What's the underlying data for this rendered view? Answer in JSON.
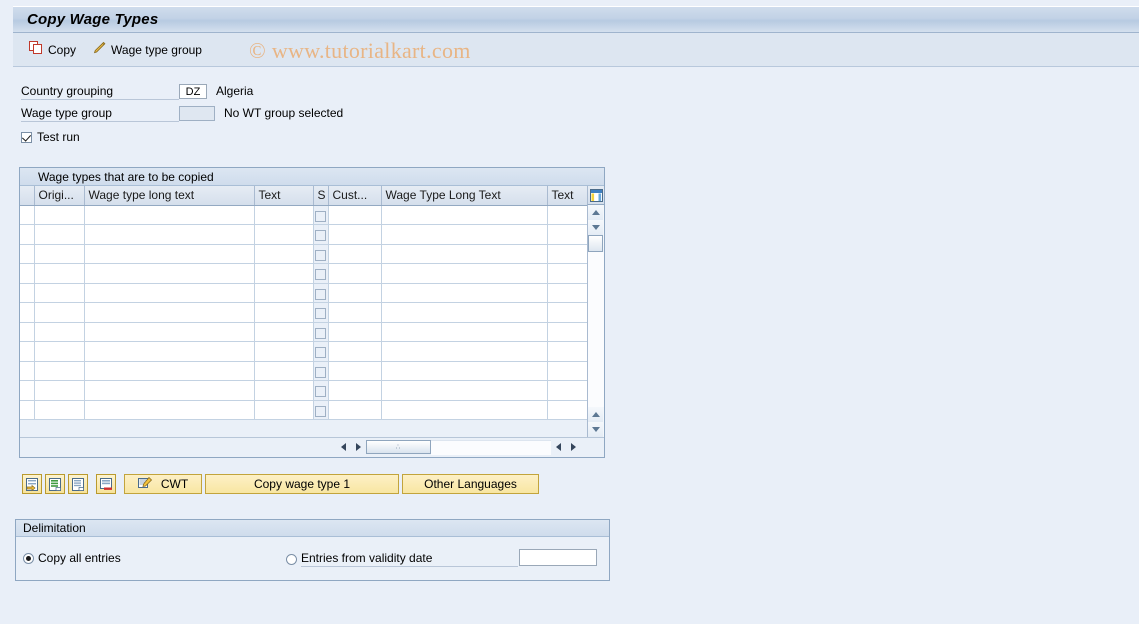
{
  "window": {
    "title": "Copy Wage Types"
  },
  "toolbar": {
    "copy_label": "Copy",
    "wage_type_group_label": "Wage type group",
    "watermark": "© www.tutorialkart.com"
  },
  "form": {
    "country_grouping_label": "Country grouping",
    "country_grouping_value": "DZ",
    "country_grouping_desc": "Algeria",
    "wage_type_group_label": "Wage type group",
    "wage_type_group_value": "",
    "wage_type_group_desc": "No WT group selected",
    "test_run_label": "Test run",
    "test_run_checked": true
  },
  "table": {
    "caption": "Wage types that are to be copied",
    "columns": [
      {
        "key": "select",
        "label": ""
      },
      {
        "key": "origin",
        "label": "Origi..."
      },
      {
        "key": "wage_type_long_text",
        "label": "Wage type long text"
      },
      {
        "key": "text1",
        "label": "Text"
      },
      {
        "key": "s",
        "label": "S"
      },
      {
        "key": "cust",
        "label": "Cust..."
      },
      {
        "key": "wage_type_long_text_2",
        "label": "Wage Type Long Text"
      },
      {
        "key": "text2",
        "label": "Text"
      }
    ],
    "settings_icon": "table-settings-icon",
    "row_count": 11,
    "rows": [
      {
        "origin": "",
        "wage_type_long_text": "",
        "text1": "",
        "s": false,
        "cust": "",
        "wage_type_long_text_2": "",
        "text2": ""
      },
      {
        "origin": "",
        "wage_type_long_text": "",
        "text1": "",
        "s": false,
        "cust": "",
        "wage_type_long_text_2": "",
        "text2": ""
      },
      {
        "origin": "",
        "wage_type_long_text": "",
        "text1": "",
        "s": false,
        "cust": "",
        "wage_type_long_text_2": "",
        "text2": ""
      },
      {
        "origin": "",
        "wage_type_long_text": "",
        "text1": "",
        "s": false,
        "cust": "",
        "wage_type_long_text_2": "",
        "text2": ""
      },
      {
        "origin": "",
        "wage_type_long_text": "",
        "text1": "",
        "s": false,
        "cust": "",
        "wage_type_long_text_2": "",
        "text2": ""
      },
      {
        "origin": "",
        "wage_type_long_text": "",
        "text1": "",
        "s": false,
        "cust": "",
        "wage_type_long_text_2": "",
        "text2": ""
      },
      {
        "origin": "",
        "wage_type_long_text": "",
        "text1": "",
        "s": false,
        "cust": "",
        "wage_type_long_text_2": "",
        "text2": ""
      },
      {
        "origin": "",
        "wage_type_long_text": "",
        "text1": "",
        "s": false,
        "cust": "",
        "wage_type_long_text_2": "",
        "text2": ""
      },
      {
        "origin": "",
        "wage_type_long_text": "",
        "text1": "",
        "s": false,
        "cust": "",
        "wage_type_long_text_2": "",
        "text2": ""
      },
      {
        "origin": "",
        "wage_type_long_text": "",
        "text1": "",
        "s": false,
        "cust": "",
        "wage_type_long_text_2": "",
        "text2": ""
      },
      {
        "origin": "",
        "wage_type_long_text": "",
        "text1": "",
        "s": false,
        "cust": "",
        "wage_type_long_text_2": "",
        "text2": ""
      }
    ],
    "hscroll_thumb_label": "∴"
  },
  "buttons": {
    "icon_buttons": [
      {
        "name": "select-all-icon-button"
      },
      {
        "name": "select-block-icon-button"
      },
      {
        "name": "deselect-icon-button"
      },
      {
        "name": "delete-row-icon-button"
      }
    ],
    "cwt_label": "CWT",
    "copy_wage_type_label": "Copy wage type 1",
    "other_languages_label": "Other Languages"
  },
  "delimitation": {
    "caption": "Delimitation",
    "option_all_label": "Copy all entries",
    "option_all_selected": true,
    "option_validity_label": "Entries from validity date",
    "option_validity_selected": false,
    "validity_date_value": ""
  },
  "colors": {
    "page_background": "#e9eff8",
    "title_bar": "#c2d2e6",
    "panel_border": "#8fa7c2",
    "button_yellow": "#f8e6a2",
    "watermark": "#e8b585",
    "row_alt": "#e3ecf6"
  }
}
